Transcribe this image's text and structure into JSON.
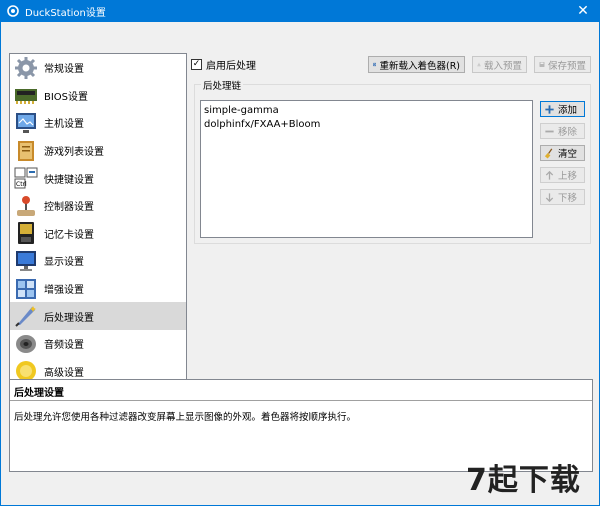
{
  "window": {
    "title": "DuckStation设置",
    "close_glyph": "✕"
  },
  "sidebar": {
    "items": [
      {
        "label": "常规设置",
        "icon": "gear-icon"
      },
      {
        "label": "BIOS设置",
        "icon": "bios-chip-icon"
      },
      {
        "label": "主机设置",
        "icon": "console-monitor-icon"
      },
      {
        "label": "游戏列表设置",
        "icon": "game-list-icon"
      },
      {
        "label": "快捷键设置",
        "icon": "keyboard-shortcut-icon"
      },
      {
        "label": "控制器设置",
        "icon": "joystick-icon"
      },
      {
        "label": "记忆卡设置",
        "icon": "memory-card-icon"
      },
      {
        "label": "显示设置",
        "icon": "display-monitor-icon"
      },
      {
        "label": "增强设置",
        "icon": "enhancement-icon"
      },
      {
        "label": "后处理设置",
        "icon": "post-processing-icon"
      },
      {
        "label": "音频设置",
        "icon": "speaker-icon"
      },
      {
        "label": "高级设置",
        "icon": "advanced-icon"
      }
    ],
    "active_index": 9
  },
  "main": {
    "enable_label": "启用后处理",
    "enable_checked": true,
    "reload_button": "重新载入着色器(R)",
    "load_preset_button": "载入预置",
    "save_preset_button": "保存预置",
    "chain_title": "后处理链",
    "chain_items": [
      "simple-gamma",
      "dolphinfx/FXAA+Bloom"
    ],
    "add_button": "添加",
    "remove_button": "移除",
    "clear_button": "清空",
    "move_up_button": "上移",
    "move_down_button": "下移"
  },
  "description": {
    "title": "后处理设置",
    "text": "后处理允许您使用各种过滤器改变屏幕上显示图像的外观。着色器将按顺序执行。"
  },
  "watermark": "7起下载"
}
